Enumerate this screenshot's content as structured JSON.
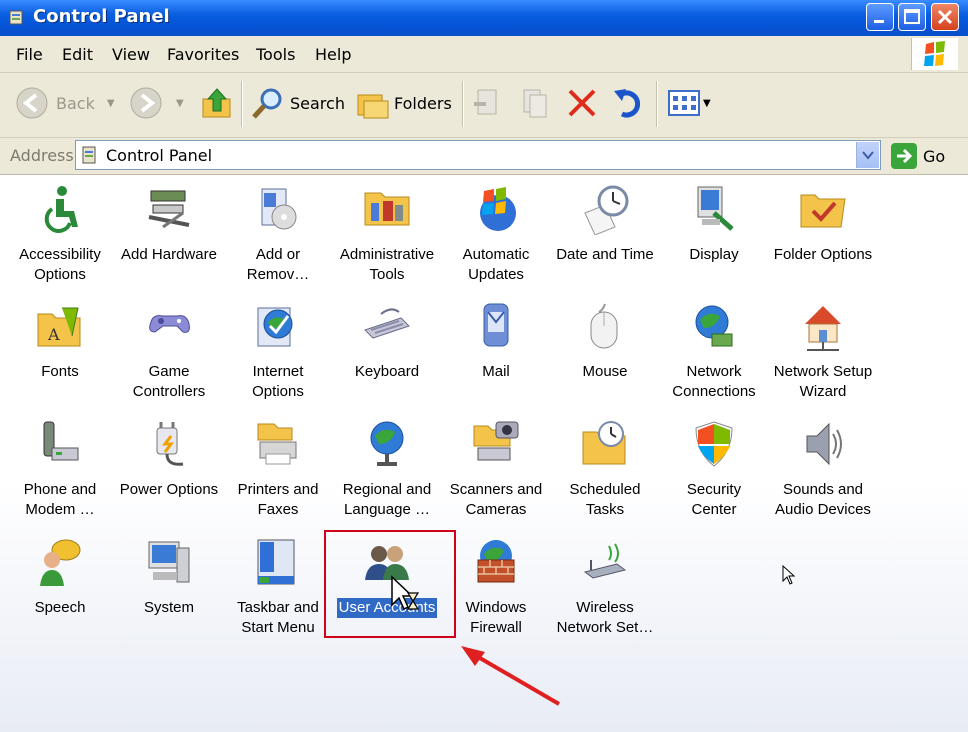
{
  "window": {
    "title": "Control Panel"
  },
  "menu": [
    "File",
    "Edit",
    "View",
    "Favorites",
    "Tools",
    "Help"
  ],
  "toolbar": {
    "back": "Back",
    "search": "Search",
    "folders": "Folders"
  },
  "address": {
    "label": "Address",
    "value": "Control Panel",
    "go": "Go"
  },
  "items": [
    {
      "label": "Accessibility\nOptions",
      "icon": "accessibility-icon"
    },
    {
      "label": "Add Hardware",
      "icon": "add-hardware-icon"
    },
    {
      "label": "Add or\nRemov…",
      "icon": "add-remove-programs-icon"
    },
    {
      "label": "Administrative\nTools",
      "icon": "administrative-tools-icon"
    },
    {
      "label": "Automatic\nUpdates",
      "icon": "automatic-updates-icon"
    },
    {
      "label": "Date and Time",
      "icon": "date-time-icon"
    },
    {
      "label": "Display",
      "icon": "display-icon"
    },
    {
      "label": "Folder Options",
      "icon": "folder-options-icon"
    },
    {
      "label": "Fonts",
      "icon": "fonts-icon"
    },
    {
      "label": "Game\nControllers",
      "icon": "game-controllers-icon"
    },
    {
      "label": "Internet\nOptions",
      "icon": "internet-options-icon"
    },
    {
      "label": "Keyboard",
      "icon": "keyboard-icon"
    },
    {
      "label": "Mail",
      "icon": "mail-icon"
    },
    {
      "label": "Mouse",
      "icon": "mouse-icon"
    },
    {
      "label": "Network\nConnections",
      "icon": "network-connections-icon"
    },
    {
      "label": "Network Setup\nWizard",
      "icon": "network-setup-wizard-icon"
    },
    {
      "label": "Phone and\nModem …",
      "icon": "phone-modem-icon"
    },
    {
      "label": "Power Options",
      "icon": "power-options-icon"
    },
    {
      "label": "Printers and\nFaxes",
      "icon": "printers-faxes-icon"
    },
    {
      "label": "Regional and\nLanguage …",
      "icon": "regional-language-icon"
    },
    {
      "label": "Scanners and\nCameras",
      "icon": "scanners-cameras-icon"
    },
    {
      "label": "Scheduled\nTasks",
      "icon": "scheduled-tasks-icon"
    },
    {
      "label": "Security\nCenter",
      "icon": "security-center-icon"
    },
    {
      "label": "Sounds and\nAudio Devices",
      "icon": "sounds-audio-icon"
    },
    {
      "label": "Speech",
      "icon": "speech-icon"
    },
    {
      "label": "System",
      "icon": "system-icon"
    },
    {
      "label": "Taskbar and\nStart Menu",
      "icon": "taskbar-start-menu-icon"
    },
    {
      "label": "User Accounts",
      "icon": "user-accounts-icon",
      "selected": true
    },
    {
      "label": "Windows\nFirewall",
      "icon": "windows-firewall-icon"
    },
    {
      "label": "Wireless\nNetwork Set…",
      "icon": "wireless-network-icon"
    }
  ],
  "colors": {
    "titlebar": "#0553d6",
    "selection": "#316ac5",
    "annotation": "#d0021b"
  }
}
